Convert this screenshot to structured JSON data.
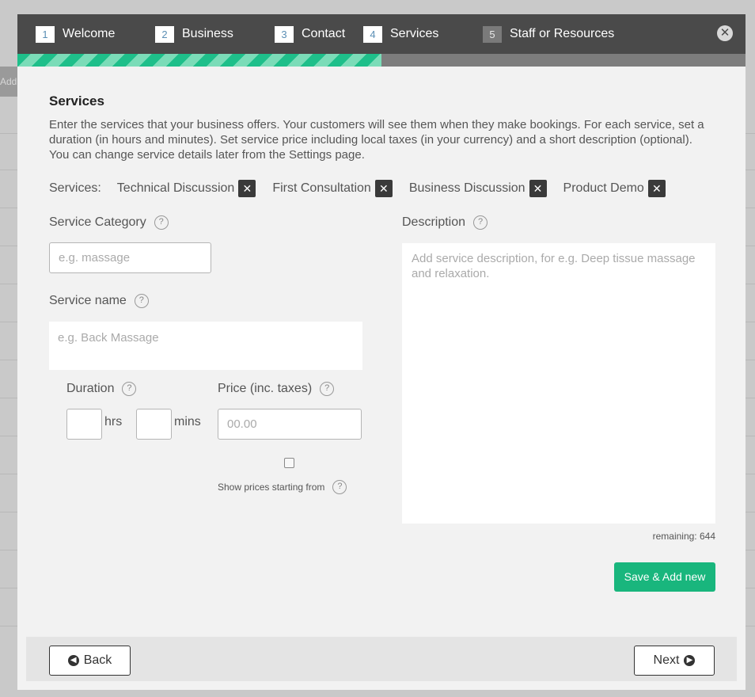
{
  "background": {
    "add_label": "Add"
  },
  "wizard": {
    "steps": [
      {
        "num": "1",
        "label": "Welcome"
      },
      {
        "num": "2",
        "label": "Business"
      },
      {
        "num": "3",
        "label": "Contact"
      },
      {
        "num": "4",
        "label": "Services"
      },
      {
        "num": "5",
        "label": "Staff or Resources"
      }
    ],
    "progress_percent": 50
  },
  "main": {
    "title": "Services",
    "intro": "Enter the services that your business offers. Your customers will see them when they make bookings. For each service, set a duration (in hours and minutes). Set service price including local taxes (in your currency) and a short description (optional). You can change service details later from the Settings page.",
    "services_label": "Services:",
    "services": [
      "Technical Discussion",
      "First Consultation",
      "Business Discussion",
      "Product Demo"
    ],
    "category": {
      "label": "Service Category",
      "placeholder": "e.g. massage"
    },
    "service_name": {
      "label": "Service name",
      "placeholder": "e.g. Back Massage"
    },
    "duration": {
      "label": "Duration",
      "hrs_unit": "hrs",
      "mins_unit": "mins"
    },
    "price": {
      "label": "Price (inc. taxes)",
      "placeholder": "00.00"
    },
    "show_prices_label": "Show prices starting from",
    "description": {
      "label": "Description",
      "placeholder": "Add service description, for e.g. Deep tissue massage and relaxation."
    },
    "remaining": "remaining: 644",
    "save_button": "Save & Add new"
  },
  "footer": {
    "back_label": "Back",
    "next_label": "Next"
  },
  "colors": {
    "accent": "#19b67d",
    "header_bg": "#4a4a4a",
    "step_num": "#5b8fb5"
  }
}
